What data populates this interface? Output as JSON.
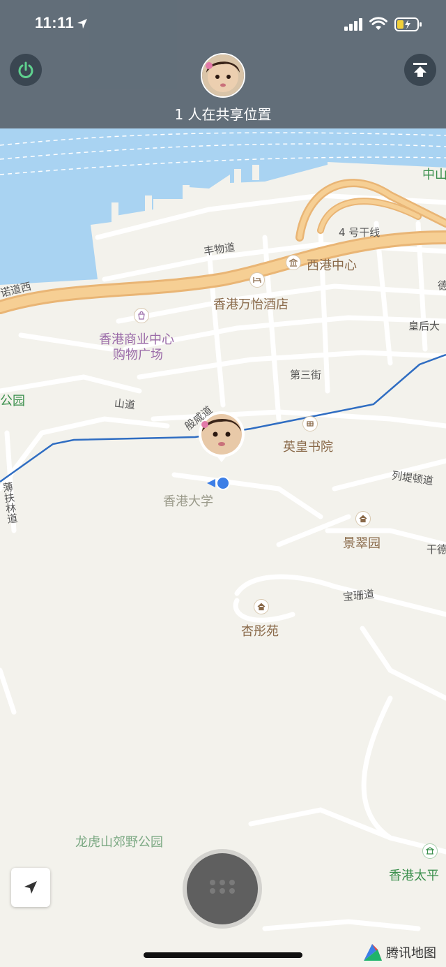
{
  "status_bar": {
    "time": "11:11"
  },
  "header": {
    "share_text": "1 人在共享位置"
  },
  "map_labels": {
    "zhongshan": "中山",
    "highway": "4 号干线",
    "fengwu_road": "丰物道",
    "western_market": "西港中心",
    "hotel": "香港万怡酒店",
    "connaught_west": "诺道西",
    "mall_line1": "香港商业中心",
    "mall_line2": "购物广场",
    "queens_road": "皇后大",
    "de": "德",
    "third_street": "第三街",
    "park_left": "公园",
    "shan_road": "山道",
    "ban_xian_road": "般咸道",
    "college": "英皇书院",
    "pokfulam_road": "薄扶林道",
    "hku": "香港大学",
    "lyttelton_road": "列堤顿道",
    "king_chui_garden": "景翠园",
    "kon_tak": "干德",
    "po_shan_road": "宝珊道",
    "heng_tung_garden": "杏彤苑",
    "lung_fu_shan_park": "龙虎山郊野公园",
    "peak_pavilion": "香港太平",
    "brand_name": "腾讯地图"
  },
  "colors": {
    "water": "#a9d3f2",
    "land": "#f3f2ec",
    "highway": "#f2c27e",
    "route": "#2f6dc2",
    "header_bg": "#566470",
    "accent_green": "#5fd18f"
  },
  "icons": {
    "power": "power-icon",
    "upload": "upload-top-icon",
    "locate": "navigation-arrow-icon",
    "menu": "grid-menu-icon"
  }
}
